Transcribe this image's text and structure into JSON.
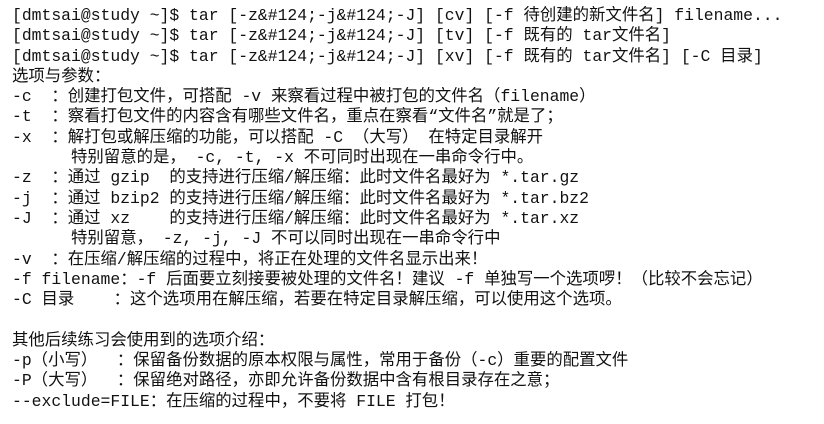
{
  "terminal": {
    "lines": [
      "[dmtsai@study ~]$ tar [-z&#124;-j&#124;-J] [cv] [-f 待创建的新文件名] filename...",
      "[dmtsai@study ~]$ tar [-z&#124;-j&#124;-J] [tv] [-f 既有的 tar文件名]",
      "[dmtsai@study ~]$ tar [-z&#124;-j&#124;-J] [xv] [-f 既有的 tar文件名] [-C 目录]",
      "选项与参数：",
      "-c  ：创建打包文件，可搭配 -v 来察看过程中被打包的文件名（filename）",
      "-t  ：察看打包文件的内容含有哪些文件名，重点在察看“文件名”就是了；",
      "-x  ：解打包或解压缩的功能，可以搭配 -C （大写） 在特定目录解开",
      "      特别留意的是， -c, -t, -x 不可同时出现在一串命令行中。",
      "-z  ：通过 gzip  的支持进行压缩/解压缩：此时文件名最好为 *.tar.gz",
      "-j  ：通过 bzip2 的支持进行压缩/解压缩：此时文件名最好为 *.tar.bz2",
      "-J  ：通过 xz    的支持进行压缩/解压缩：此时文件名最好为 *.tar.xz",
      "      特别留意， -z, -j, -J 不可以同时出现在一串命令行中",
      "-v  ：在压缩/解压缩的过程中，将正在处理的文件名显示出来！",
      "-f filename：-f 后面要立刻接要被处理的文件名！建议 -f 单独写一个选项啰！（比较不会忘记）",
      "-C 目录    ：这个选项用在解压缩，若要在特定目录解压缩，可以使用这个选项。",
      "",
      "其他后续练习会使用到的选项介绍：",
      "-p（小写）  ：保留备份数据的原本权限与属性，常用于备份（-c）重要的配置文件",
      "-P（大写）  ：保留绝对路径，亦即允许备份数据中含有根目录存在之意；",
      "--exclude=FILE：在压缩的过程中，不要将 FILE 打包！"
    ]
  }
}
